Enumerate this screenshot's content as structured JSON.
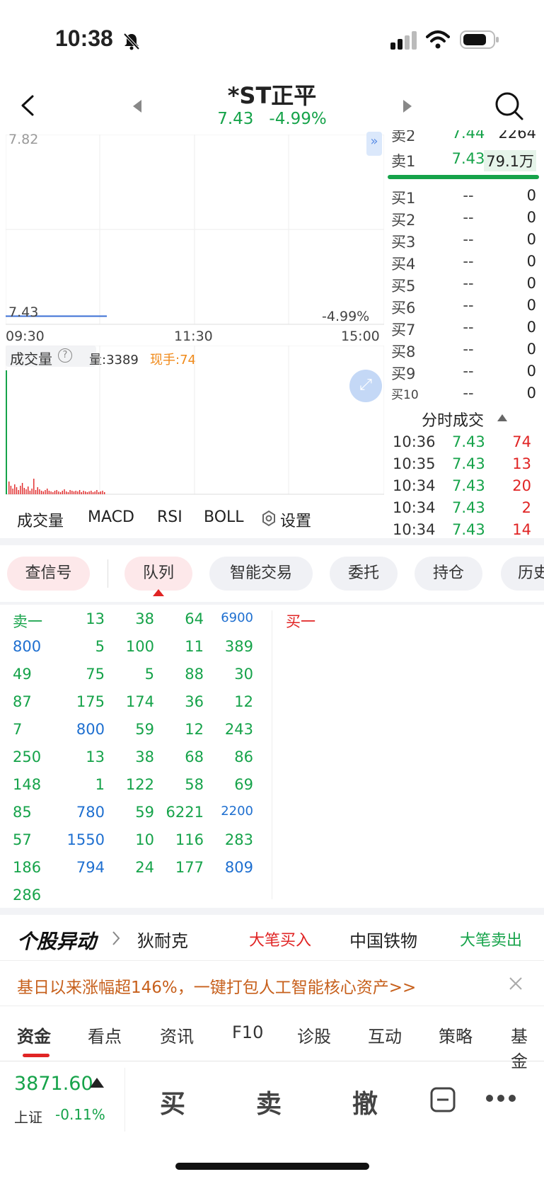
{
  "status": {
    "time": "10:38"
  },
  "header": {
    "name": "*ST正平",
    "price": "7.43",
    "change": "-4.99%"
  },
  "chart": {
    "top_price": "7.82",
    "cur_price": "7.43",
    "cur_change": "-4.99%",
    "x_ticks": [
      "09:30",
      "11:30",
      "15:00"
    ],
    "vol_label": "成交量",
    "vol_info": "量:3389",
    "now_hand": "现手:74"
  },
  "chart_data": {
    "type": "line",
    "x": [
      "09:30",
      "11:30",
      "15:00"
    ],
    "series": [
      {
        "values": [
          7.43,
          7.43
        ]
      }
    ]
  },
  "orderbook": {
    "sell": [
      {
        "label": "卖2",
        "price": "7.44",
        "vol": "2264"
      },
      {
        "label": "卖1",
        "price": "7.43",
        "vol": "79.1万"
      }
    ],
    "buy": [
      {
        "label": "买1",
        "price": "--",
        "vol": "0"
      },
      {
        "label": "买2",
        "price": "--",
        "vol": "0"
      },
      {
        "label": "买3",
        "price": "--",
        "vol": "0"
      },
      {
        "label": "买4",
        "price": "--",
        "vol": "0"
      },
      {
        "label": "买5",
        "price": "--",
        "vol": "0"
      },
      {
        "label": "买6",
        "price": "--",
        "vol": "0"
      },
      {
        "label": "买7",
        "price": "--",
        "vol": "0"
      },
      {
        "label": "买8",
        "price": "--",
        "vol": "0"
      },
      {
        "label": "买9",
        "price": "--",
        "vol": "0"
      },
      {
        "label": "买10",
        "price": "--",
        "vol": "0"
      }
    ]
  },
  "trades": {
    "title": "分时成交",
    "rows": [
      {
        "time": "10:36",
        "price": "7.43",
        "vol": "74"
      },
      {
        "time": "10:35",
        "price": "7.43",
        "vol": "13"
      },
      {
        "time": "10:34",
        "price": "7.43",
        "vol": "20"
      },
      {
        "time": "10:34",
        "price": "7.43",
        "vol": "2"
      },
      {
        "time": "10:34",
        "price": "7.43",
        "vol": "14"
      }
    ]
  },
  "indicators": {
    "vol": "成交量",
    "macd": "MACD",
    "rsi": "RSI",
    "boll": "BOLL",
    "settings": "设置"
  },
  "tabs": {
    "signal": "查信号",
    "queue": "队列",
    "smart": "智能交易",
    "order": "委托",
    "position": "持仓",
    "history": "历史"
  },
  "queue": {
    "sell_header": "卖一",
    "buy_header": "买一",
    "rows": [
      [
        "卖一",
        "13",
        "38",
        "64",
        "6900"
      ],
      [
        "800",
        "5",
        "100",
        "11",
        "389"
      ],
      [
        "49",
        "75",
        "5",
        "88",
        "30"
      ],
      [
        "87",
        "175",
        "174",
        "36",
        "12"
      ],
      [
        "7",
        "800",
        "59",
        "12",
        "243"
      ],
      [
        "250",
        "13",
        "38",
        "68",
        "86"
      ],
      [
        "148",
        "1",
        "122",
        "58",
        "69"
      ],
      [
        "85",
        "780",
        "59",
        "6221",
        "2200"
      ],
      [
        "57",
        "1550",
        "10",
        "116",
        "283"
      ],
      [
        "186",
        "794",
        "24",
        "177",
        "809"
      ],
      [
        "286",
        "",
        "",
        "",
        ""
      ]
    ]
  },
  "movers": {
    "title": "个股异动",
    "s1": "狄耐克",
    "t1": "大笔买入",
    "s2": "中国铁物",
    "t2": "大笔卖出"
  },
  "news": {
    "text": "基日以来涨幅超146%，一键打包人工智能核心资产>>"
  },
  "bottom_tabs": {
    "t1": "资金",
    "t2": "看点",
    "t3": "资讯",
    "t4": "F10",
    "t5": "诊股",
    "t6": "互动",
    "t7": "策略",
    "t8": "基金"
  },
  "index": {
    "value": "3871.60",
    "name": "上证",
    "change": "-0.11%"
  },
  "actions": {
    "buy": "买",
    "sell": "卖",
    "cancel": "撤"
  }
}
